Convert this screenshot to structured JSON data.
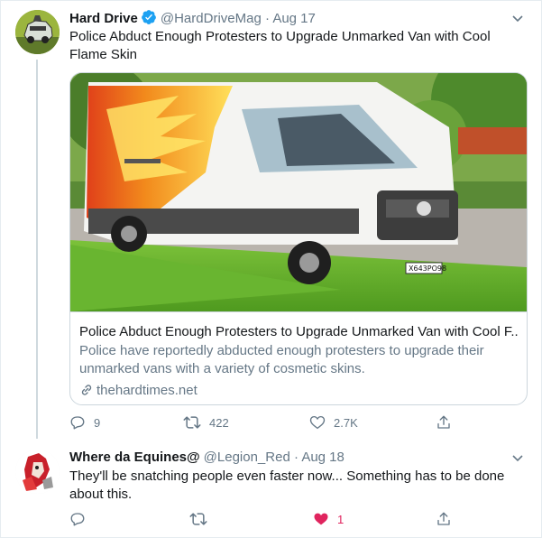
{
  "tweets": [
    {
      "display_name": "Hard Drive",
      "handle": "@HardDriveMag",
      "separator": "·",
      "date": "Aug 17",
      "verified": true,
      "text": "Police Abduct Enough Protesters to Upgrade Unmarked Van with Cool Flame Skin",
      "card": {
        "title": "Police Abduct Enough Protesters to Upgrade Unmarked Van with Cool F...",
        "description": "Police have reportedly abducted enough protesters to upgrade their unmarked vans with a variety of cosmetic skins.",
        "domain": "thehardtimes.net",
        "plate": "Х643РО98"
      },
      "actions": {
        "replies": "9",
        "retweets": "422",
        "likes": "2.7K"
      }
    },
    {
      "display_name": "Where da Equines@",
      "handle": "@Legion_Red",
      "separator": "·",
      "date": "Aug 18",
      "verified": false,
      "text": "They'll be snatching people even faster now... Something has to be done about this.",
      "actions": {
        "replies": "",
        "retweets": "",
        "likes": "1",
        "liked": true
      }
    }
  ],
  "colors": {
    "text": "#14171a",
    "secondary": "#657786",
    "border": "#ccd6dd",
    "verified": "#1da1f2",
    "like": "#e0245e"
  },
  "icons": [
    "verified-badge-icon",
    "chevron-down-icon",
    "reply-icon",
    "retweet-icon",
    "like-icon",
    "share-icon",
    "link-icon"
  ]
}
